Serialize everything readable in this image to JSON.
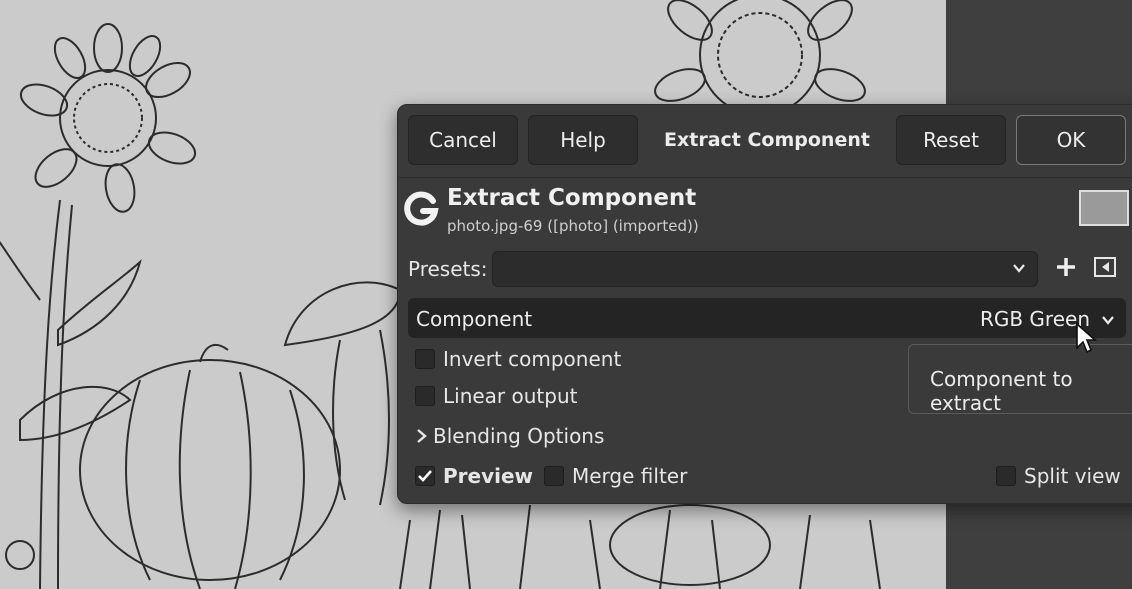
{
  "dialog": {
    "buttons": {
      "cancel": "Cancel",
      "help": "Help",
      "reset": "Reset",
      "ok": "OK"
    },
    "title": "Extract Component",
    "operation_title": "Extract Component",
    "operation_subtitle": "photo.jpg-69 ([photo] (imported))",
    "presets_label": "Presets:",
    "presets_value": "",
    "component": {
      "label": "Component",
      "value": "RGB Green"
    },
    "options": {
      "invert_label": "Invert component",
      "invert_checked": false,
      "linear_label": "Linear output",
      "linear_checked": false,
      "blending_label": "Blending Options"
    },
    "footer": {
      "preview_label": "Preview",
      "preview_checked": true,
      "merge_label": "Merge filter",
      "merge_checked": false,
      "split_label": "Split view",
      "split_checked": false
    }
  },
  "tooltip": {
    "text": "Component to extract"
  },
  "icons": {
    "logo": "gimp-logo-icon",
    "add": "plus-icon",
    "menu": "preset-menu-icon",
    "chevron": "chevron-down-icon",
    "expander": "chevron-right-icon",
    "cursor": "mouse-pointer-icon"
  }
}
